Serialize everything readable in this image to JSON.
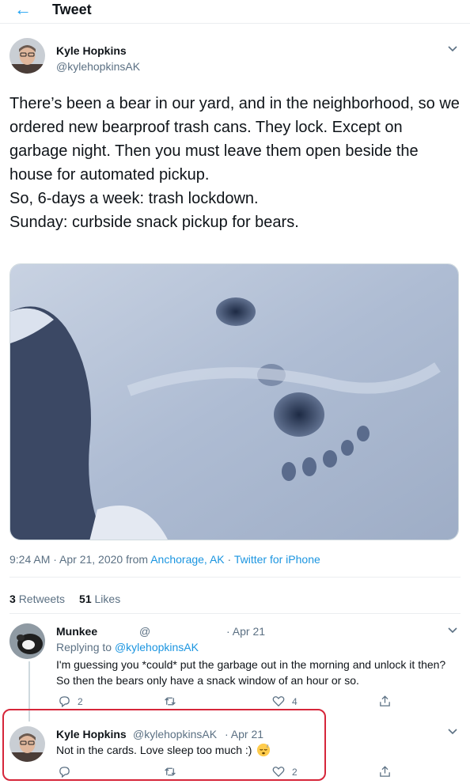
{
  "header": {
    "back_icon": "left-arrow-icon",
    "title": "Tweet"
  },
  "tweet": {
    "author_name": "Kyle Hopkins",
    "author_handle": "@kylehopkinsAK",
    "text_lines": [
      "There’s been a bear in our yard, and in the neighborhood, so we ordered new bearproof trash cans. They lock. Except on garbage night. Then you must leave them open beside the house for automated pickup.",
      "So, 6-days a week: trash lockdown.",
      "Sunday: curbside snack pickup for bears."
    ],
    "meta": {
      "time": "9:24 AM · Apr 21, 2020 from ",
      "location": "Anchorage, AK",
      "sep": " · ",
      "source": "Twitter for iPhone"
    },
    "stats": {
      "retweets_count": "3",
      "retweets_label": "Retweets",
      "likes_count": "51",
      "likes_label": "Likes"
    }
  },
  "replies": [
    {
      "name": "Munkee",
      "handle": "@",
      "date": "· Apr 21",
      "replying_prefix": "Replying to ",
      "replying_to": "@kylehopkinsAK",
      "text": "I'm guessing you *could* put the garbage out in the morning and unlock it then? So then the bears only have a snack window of an hour or so.",
      "reply_count": "2",
      "retweet_count": "",
      "like_count": "4"
    },
    {
      "name": "Kyle Hopkins",
      "handle": "@kylehopkinsAK",
      "date": "· Apr 21",
      "text": "Not in the cards. Love sleep too much :)",
      "emoji": "sleeping-face-emoji",
      "reply_count": "",
      "retweet_count": "",
      "like_count": "2"
    }
  ],
  "colors": {
    "accent": "#1da1f2",
    "link": "#1b95e0",
    "muted": "#5b7083",
    "highlight": "#d6263a"
  }
}
